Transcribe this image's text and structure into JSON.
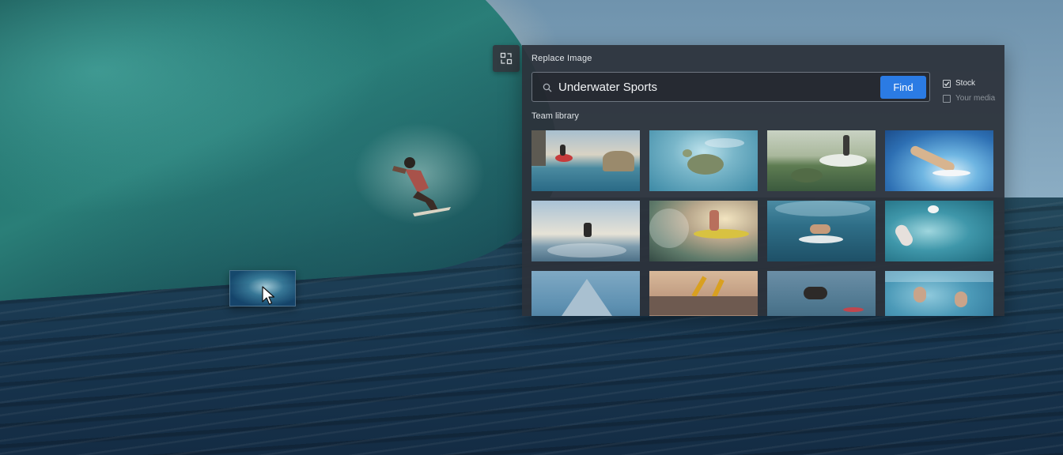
{
  "panel": {
    "title": "Replace Image",
    "search": {
      "value": "Underwater Sports",
      "placeholder": ""
    },
    "find_label": "Find",
    "filters": [
      {
        "label": "Stock",
        "checked": true
      },
      {
        "label": "Your media",
        "checked": false
      }
    ],
    "section_label": "Team library",
    "thumbnails": [
      "kayak-in-sea-caves",
      "sea-turtle-with-fish",
      "diver-with-boat",
      "swimmer-diving-under-wave",
      "kitesurfer-jumping",
      "kayaker-in-splash",
      "surfer-underwater",
      "surfer-from-above",
      "boat-bow",
      "people-paddling-at-sunset",
      "dog-on-surfboard",
      "family-swimming-underwater"
    ]
  },
  "icons": {
    "replace": "replace-image-icon",
    "search": "search-icon",
    "cursor": "cursor-icon"
  },
  "colors": {
    "accent": "#2b7be4",
    "panel_bg": "#2c323a"
  }
}
